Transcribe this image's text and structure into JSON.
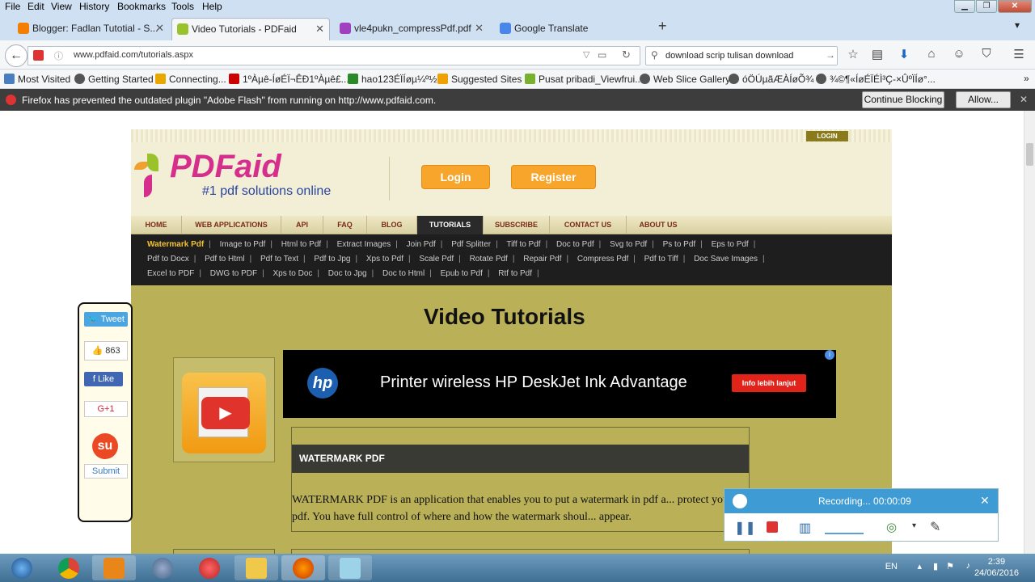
{
  "menubar": {
    "items": [
      "File",
      "Edit",
      "View",
      "History",
      "Bookmarks",
      "Tools",
      "Help"
    ]
  },
  "tabs": [
    {
      "title": "Blogger: Fadlan Tutotial - S...",
      "active": false,
      "icon_color": "#f57d00"
    },
    {
      "title": "Video Tutorials - PDFaid",
      "active": true,
      "icon_color": "#9ac22a"
    },
    {
      "title": "vle4pukn_compressPdf.pdf",
      "active": false,
      "icon_color": "#a040c0"
    },
    {
      "title": "Google Translate",
      "active": false,
      "icon_color": "#4a86e8"
    }
  ],
  "nav": {
    "url": "www.pdfaid.com/tutorials.aspx",
    "search": "download scrip tulisan download"
  },
  "bookmarks": [
    {
      "label": "Most Visited",
      "color": "#4a7fbf"
    },
    {
      "label": "Getting Started",
      "color": "#555"
    },
    {
      "label": "Connecting...",
      "color": "#e8a800"
    },
    {
      "label": "1ºÀµê-ÍøÉÏ¬ÊÐ1ºÀµê£...",
      "color": "#c00"
    },
    {
      "label": "hao123ÉÏÍøµ¼º½",
      "color": "#2a8a2a"
    },
    {
      "label": "Suggested Sites",
      "color": "#f0a000"
    },
    {
      "label": "Pusat pribadi_Viewfrui...",
      "color": "#7ab030"
    },
    {
      "label": "Web Slice Gallery",
      "color": "#555"
    },
    {
      "label": "óÖÚµãÆÀÍøÕ¾",
      "color": "#555"
    },
    {
      "label": "¾©¶«ÍøÉÏÉÌ³Ç-×ÛºÏÍø°...",
      "color": "#555"
    }
  ],
  "notification": {
    "text": "Firefox has prevented the outdated plugin \"Adobe Flash\" from running on http://www.pdfaid.com.",
    "continue_label": "Continue Blocking",
    "allow_label": "Allow..."
  },
  "site": {
    "top_login": "LOGIN",
    "logo": "PDFaid",
    "tagline": "#1 pdf solutions online",
    "login_btn": "Login",
    "register_btn": "Register",
    "main_nav": [
      "HOME",
      "WEB APPLICATIONS",
      "API",
      "FAQ",
      "BLOG",
      "TUTORIALS",
      "SUBSCRIBE",
      "CONTACT US",
      "ABOUT US"
    ],
    "sub_nav_rows": [
      [
        "Watermark Pdf",
        "Image to Pdf",
        "Html to Pdf",
        "Extract Images",
        "Join Pdf",
        "Pdf Splitter",
        "Tiff to Pdf",
        "Doc to Pdf",
        "Svg to Pdf",
        "Ps to Pdf",
        "Eps to Pdf"
      ],
      [
        "Pdf to Docx",
        "Pdf to Html",
        "Pdf to Text",
        "Pdf to Jpg",
        "Xps to Pdf",
        "Scale Pdf",
        "Rotate Pdf",
        "Repair Pdf",
        "Compress Pdf",
        "Pdf to Tiff",
        "Doc Save Images"
      ],
      [
        "Excel to PDF",
        "DWG to PDF",
        "Xps to Doc",
        "Doc to Jpg",
        "Doc to Html",
        "Epub to Pdf",
        "Rtf to Pdf"
      ]
    ],
    "page_title": "Video Tutorials",
    "ad": {
      "logo": "hp",
      "text": "Printer wireless HP DeskJet Ink Advantage",
      "button": "Info lebih lanjut"
    },
    "section_heading": "WATERMARK PDF",
    "section_text": "WATERMARK PDF is an application that enables you to put a watermark in pdf a... protect your pdf. You have full control of where and how the watermark shoul... appear."
  },
  "share": {
    "tweet": "Tweet",
    "like_count": "863",
    "like": "Like",
    "gplus": "G+1",
    "submit": "Submit"
  },
  "recorder": {
    "status": "Recording... 00:00:09"
  },
  "taskbar": {
    "lang": "EN",
    "time": "2:39",
    "date": "24/06/2016"
  }
}
